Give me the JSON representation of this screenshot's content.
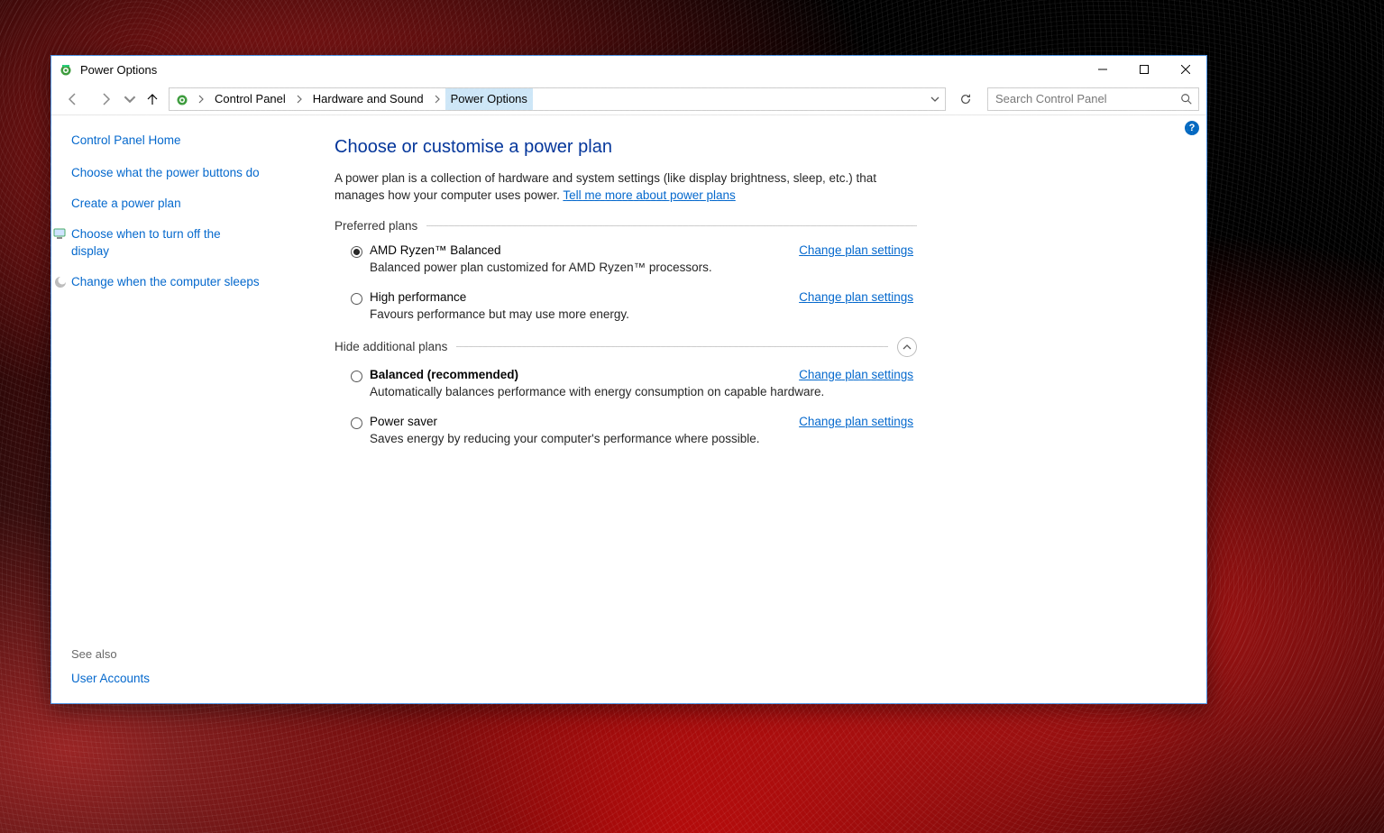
{
  "window": {
    "title": "Power Options"
  },
  "breadcrumb": {
    "items": [
      "Control Panel",
      "Hardware and Sound",
      "Power Options"
    ]
  },
  "search": {
    "placeholder": "Search Control Panel"
  },
  "sidebar": {
    "home": "Control Panel Home",
    "links": [
      "Choose what the power buttons do",
      "Create a power plan",
      "Choose when to turn off the display",
      "Change when the computer sleeps"
    ],
    "see_also_label": "See also",
    "footer_links": [
      "User Accounts"
    ]
  },
  "main": {
    "heading": "Choose or customise a power plan",
    "description_pre": "A power plan is a collection of hardware and system settings (like display brightness, sleep, etc.) that manages how your computer uses power. ",
    "description_link": "Tell me more about power plans",
    "preferred_label": "Preferred plans",
    "additional_label": "Hide additional plans",
    "change_link": "Change plan settings",
    "plans_preferred": [
      {
        "name": "AMD Ryzen™ Balanced",
        "sub": "Balanced power plan customized for AMD Ryzen™ processors.",
        "selected": true,
        "bold": false
      },
      {
        "name": "High performance",
        "sub": "Favours performance but may use more energy.",
        "selected": false,
        "bold": false
      }
    ],
    "plans_additional": [
      {
        "name": "Balanced (recommended)",
        "sub": "Automatically balances performance with energy consumption on capable hardware.",
        "selected": false,
        "bold": true
      },
      {
        "name": "Power saver",
        "sub": "Saves energy by reducing your computer's performance where possible.",
        "selected": false,
        "bold": false
      }
    ]
  }
}
